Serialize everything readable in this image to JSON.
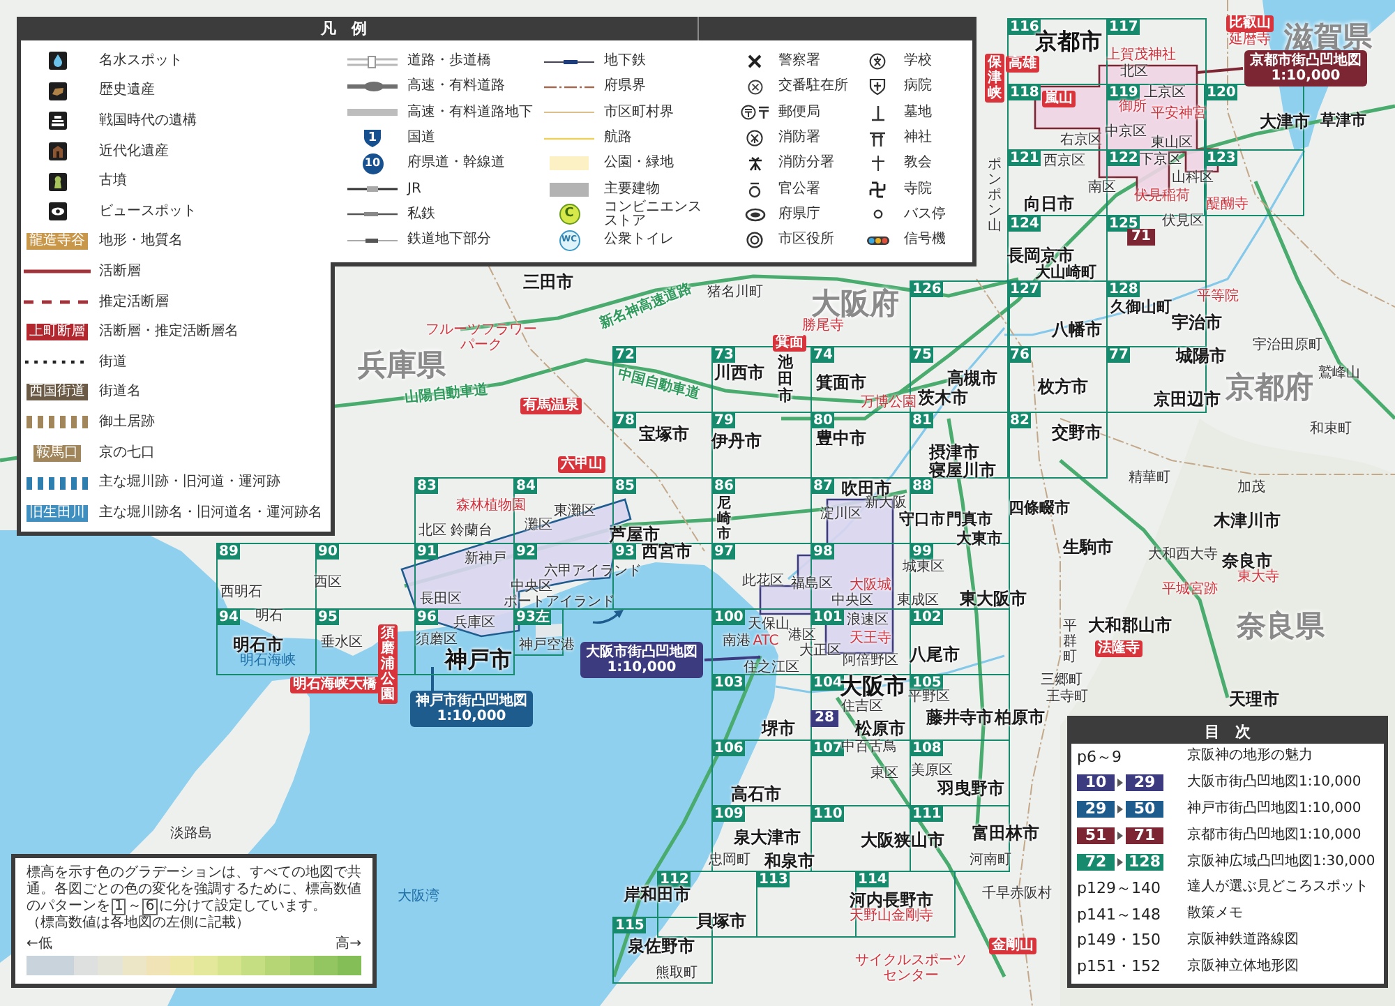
{
  "legend": {
    "title": "凡　例",
    "marks": [
      {
        "kind": "water",
        "label": "名水スポット"
      },
      {
        "kind": "heritage",
        "label": "歴史遺産"
      },
      {
        "kind": "ruins",
        "label": "戦国時代の遺構"
      },
      {
        "kind": "modern",
        "label": "近代化遺産"
      },
      {
        "kind": "tomb",
        "label": "古墳"
      },
      {
        "kind": "view",
        "label": "ビュースポット"
      },
      {
        "kind": "tag",
        "sample": "龍造寺谷",
        "color": "#c8974a",
        "label": "地形・地質名"
      },
      {
        "kind": "line",
        "color": "#a3333b",
        "label": "活断層"
      },
      {
        "kind": "dashed",
        "color": "#a3333b",
        "label": "推定活断層"
      },
      {
        "kind": "tag",
        "sample": "上町断層",
        "color": "#b3272f",
        "label": "活断層・推定活断層名"
      },
      {
        "kind": "dotted",
        "color": "#222222",
        "label": "街道"
      },
      {
        "kind": "tag",
        "sample": "西国街道",
        "color": "#6b5a45",
        "label": "街道名"
      },
      {
        "kind": "blocks",
        "color": "#a0865a",
        "label": "御土居跡"
      },
      {
        "kind": "tag",
        "sample": "鞍馬口",
        "color": "#a0865a",
        "label": "京の七口"
      },
      {
        "kind": "blocks",
        "color": "#2e7fb0",
        "label": "主な堀川跡・旧河道・運河跡"
      },
      {
        "kind": "tag",
        "sample": "旧生田川",
        "color": "#3f8fc0",
        "label": "主な堀川跡名・旧河道名・運河跡名"
      }
    ],
    "symbol_columns": [
      [
        {
          "kind": "road",
          "label": "道路・歩道橋"
        },
        {
          "kind": "expressway",
          "label": "高速・有料道路"
        },
        {
          "kind": "expressway-underground",
          "label": "高速・有料道路地下"
        },
        {
          "kind": "national-route",
          "number": "1",
          "label": "国道"
        },
        {
          "kind": "prefectural-route",
          "number": "10",
          "label": "府県道・幹線道"
        },
        {
          "kind": "jr",
          "label": "JR"
        },
        {
          "kind": "private-railway",
          "label": "私鉄"
        },
        {
          "kind": "railway-underground",
          "label": "鉄道地下部分"
        }
      ],
      [
        {
          "kind": "subway",
          "label": "地下鉄"
        },
        {
          "kind": "prefecture-border",
          "label": "府県界"
        },
        {
          "kind": "municipal-border",
          "label": "市区町村界"
        },
        {
          "kind": "sea-route",
          "label": "航路"
        },
        {
          "kind": "park",
          "label": "公園・緑地"
        },
        {
          "kind": "building",
          "label": "主要建物"
        },
        {
          "kind": "convenience-store",
          "symbol": "C",
          "label": "コンビニエンスストア"
        },
        {
          "kind": "toilet",
          "symbol": "WC",
          "label": "公衆トイレ"
        }
      ],
      [
        {
          "kind": "police",
          "label": "警察署"
        },
        {
          "kind": "koban",
          "label": "交番駐在所"
        },
        {
          "kind": "post-office",
          "label": "郵便局"
        },
        {
          "kind": "fire-station",
          "label": "消防署"
        },
        {
          "kind": "fire-substation",
          "label": "消防分署"
        },
        {
          "kind": "government-office",
          "label": "官公署"
        },
        {
          "kind": "prefectural-office",
          "label": "府県庁"
        },
        {
          "kind": "city-office",
          "label": "市区役所"
        }
      ],
      [
        {
          "kind": "school",
          "label": "学校"
        },
        {
          "kind": "hospital",
          "label": "病院"
        },
        {
          "kind": "cemetery",
          "label": "墓地"
        },
        {
          "kind": "shrine",
          "label": "神社"
        },
        {
          "kind": "church",
          "label": "教会"
        },
        {
          "kind": "temple",
          "label": "寺院"
        },
        {
          "kind": "bus-stop",
          "label": "バス停"
        },
        {
          "kind": "traffic-signal",
          "label": "信号機"
        }
      ]
    ]
  },
  "map": {
    "prefectures": [
      "滋賀県",
      "大阪府",
      "兵庫県",
      "京都府",
      "奈良県"
    ],
    "cities": [
      "京都市",
      "大津市",
      "草津市",
      "向日市",
      "長岡京市",
      "三田市",
      "大山崎町",
      "久御山町",
      "八幡市",
      "宇治市",
      "城陽市",
      "川西市",
      "池田市",
      "箕面市",
      "高槻市",
      "茨木市",
      "枚方市",
      "京田辺市",
      "宝塚市",
      "伊丹市",
      "豊中市",
      "交野市",
      "摂津市",
      "寝屋川市",
      "吹田市",
      "芦屋市",
      "尼崎市",
      "守口市",
      "門真市",
      "四條畷市",
      "木津川市",
      "西宮市",
      "大東市",
      "生駒市",
      "奈良市",
      "東大阪市",
      "大和郡山市",
      "明石市",
      "神戸市",
      "八尾市",
      "大阪市",
      "天理市",
      "堺市",
      "松原市",
      "藤井寺市",
      "柏原市",
      "高石市",
      "羽曳野市",
      "泉大津市",
      "大阪狭山市",
      "富田林市",
      "和泉市",
      "岸和田市",
      "河内長野市",
      "貝塚市",
      "泉佐野市"
    ],
    "places": [
      "北区",
      "上京区",
      "右京区",
      "中京区",
      "東山区",
      "ポンポン山",
      "西京区",
      "下京区",
      "南区",
      "山科区",
      "伏見区",
      "猪名川町",
      "宇治田原町",
      "鷲峰山",
      "和束町",
      "精華町",
      "加茂",
      "東灘区",
      "淀川区",
      "新大阪",
      "北区",
      "鈴蘭台",
      "灘区",
      "新神戸",
      "大和西大寺",
      "六甲アイランド",
      "城東区",
      "西明石",
      "西区",
      "中央区",
      "此花区",
      "福島区",
      "長田区",
      "ポートアイランド",
      "中央区",
      "東成区",
      "明石",
      "兵庫区",
      "天保山",
      "浪速区",
      "垂水区",
      "須磨区",
      "神戸空港",
      "南港",
      "港区",
      "大正区",
      "住之江区",
      "阿倍野区",
      "平群町",
      "三郷町",
      "住吉区",
      "平野区",
      "王寺町",
      "中百舌鳥",
      "東区",
      "美原区",
      "淡路島",
      "忠岡町",
      "河南町",
      "千早赤阪村",
      "熊取町"
    ],
    "sights": [
      "延暦寺",
      "上賀茂神社",
      "御所",
      "平安神宮",
      "伏見稲荷",
      "醍醐寺",
      "平等院",
      "フルーツフラワーパーク",
      "勝尾寺",
      "万博公園",
      "森林植物園",
      "大阪城",
      "平城宮跡",
      "東大寺",
      "ATC",
      "天王寺",
      "天野山金剛寺",
      "サイクルスポーツセンター"
    ],
    "spots": [
      "比叡山",
      "保津峡",
      "高雄",
      "嵐山",
      "箕面",
      "有馬温泉",
      "六甲山",
      "須磨浦公園",
      "法隆寺",
      "明石海峡大橋",
      "金剛山"
    ],
    "roads": [
      "新名神高速道路",
      "山陽自動車道",
      "中国自動車道"
    ],
    "waters": [
      "明石海峡",
      "大阪湾"
    ],
    "pages": [
      "116",
      "117",
      "118",
      "119",
      "120",
      "121",
      "122",
      "123",
      "124",
      "125",
      "126",
      "127",
      "128",
      "72",
      "73",
      "74",
      "75",
      "76",
      "77",
      "78",
      "79",
      "80",
      "81",
      "82",
      "83",
      "84",
      "85",
      "86",
      "87",
      "88",
      "89",
      "90",
      "91",
      "92",
      "93",
      "97",
      "98",
      "99",
      "94",
      "95",
      "96",
      "93左",
      "100",
      "101",
      "102",
      "103",
      "104",
      "105",
      "106",
      "107",
      "108",
      "109",
      "110",
      "111",
      "112",
      "113",
      "114",
      "115"
    ],
    "city_pages": [
      {
        "page": "71",
        "color": "#7d2633"
      },
      {
        "page": "28",
        "color": "#3d3b80"
      }
    ],
    "callouts": [
      {
        "title": "京都市街凸凹地図",
        "scale": "1:10,000",
        "color": "#7d2633"
      },
      {
        "title": "大阪市街凸凹地図",
        "scale": "1:10,000",
        "color": "#3d3b80"
      },
      {
        "title": "神戸市街凸凹地図",
        "scale": "1:10,000",
        "color": "#1f5c8e"
      }
    ]
  },
  "contents": {
    "title": "目　次",
    "rows": [
      {
        "kind": "pages",
        "pages": "p6～9",
        "title": "京阪神の地形の魅力"
      },
      {
        "kind": "range",
        "from": "10",
        "to": "29",
        "color": "#3d3b80",
        "title": "大阪市街凸凹地図1:10,000"
      },
      {
        "kind": "range",
        "from": "29",
        "to": "50",
        "color": "#1f5c8e",
        "title": "神戸市街凸凹地図1:10,000"
      },
      {
        "kind": "range",
        "from": "51",
        "to": "71",
        "color": "#7d2633",
        "title": "京都市街凸凹地図1:10,000"
      },
      {
        "kind": "range",
        "from": "72",
        "to": "128",
        "color": "#178a6e",
        "title": "京阪神広域凸凹地図1:30,000"
      },
      {
        "kind": "pages",
        "pages": "p129～140",
        "title": "達人が選ぶ見どころスポット"
      },
      {
        "kind": "pages",
        "pages": "p141～148",
        "title": "散策メモ"
      },
      {
        "kind": "pages",
        "pages": "p149・150",
        "title": "京阪神鉄道路線図"
      },
      {
        "kind": "pages",
        "pages": "p151・152",
        "title": "京阪神立体地形図"
      }
    ]
  },
  "elevation_note": {
    "before": "標高を示す色のグラデーションは、すべての地図で共通。各図ごとの色の変化を強調するために、標高数値のパターンを",
    "range_start": "1",
    "range_mark": "～",
    "range_end": "6",
    "after": "に分けて設定しています。",
    "aside": "（標高数値は各地図の左側に記載）",
    "low_label": "←低",
    "high_label": "高→"
  }
}
